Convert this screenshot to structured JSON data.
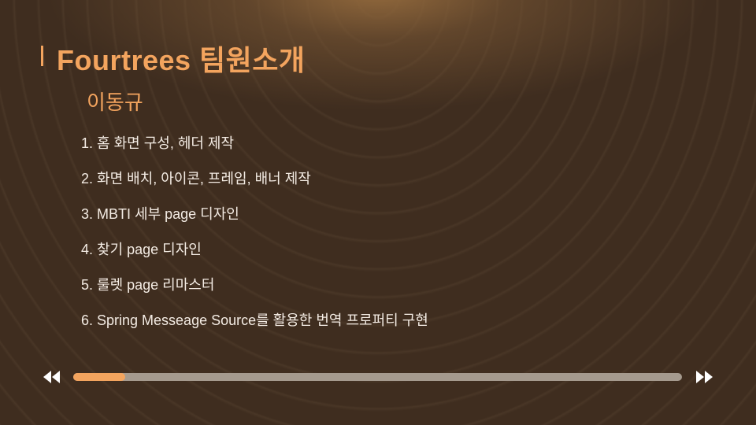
{
  "slide": {
    "title": "Fourtrees 팀원소개",
    "subtitle": "이동규",
    "items": [
      "1. 홈 화면 구성, 헤더 제작",
      "2. 화면 배치, 아이콘, 프레임, 배너 제작",
      "3.  MBTI 세부 page 디자인",
      "4. 찾기 page 디자인",
      "5. 룰렛 page 리마스터",
      "6. Spring Messeage Source를 활용한 번역 프로퍼티 구현"
    ]
  },
  "player": {
    "rewind_icon": "rewind-icon",
    "forward_icon": "fast-forward-icon",
    "progress": 0.085
  },
  "colors": {
    "accent": "#f3a45e",
    "background": "#3f2d1f",
    "text": "#f4ece4",
    "track": "#a59a8e"
  }
}
